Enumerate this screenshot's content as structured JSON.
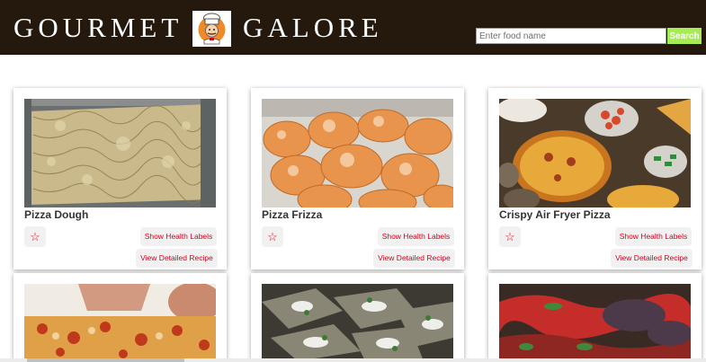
{
  "header": {
    "brand_left": "GOURMET",
    "brand_right": "GALORE",
    "logo_icon": "chef-logo-icon",
    "search_placeholder": "Enter food name",
    "search_button": "Search",
    "colors": {
      "background": "#25190e",
      "search_button": "#a8ec55",
      "accent": "#d9001b"
    }
  },
  "recipes": [
    {
      "title": "Pizza Dough",
      "image": "pizza-dough-photo",
      "health_label": "Show Health Labels",
      "recipe_label": "View Detailed Recipe",
      "star_icon": "star-outline-icon"
    },
    {
      "title": "Pizza Frizza",
      "image": "fried-dough-balls-photo",
      "health_label": "Show Health Labels",
      "recipe_label": "View Detailed Recipe",
      "star_icon": "star-outline-icon"
    },
    {
      "title": "Crispy Air Fryer Pizza",
      "image": "pizza-toppings-spread-photo",
      "health_label": "Show Health Labels",
      "recipe_label": "View Detailed Recipe",
      "star_icon": "star-outline-icon"
    },
    {
      "image": "pizza-with-hands-photo"
    },
    {
      "image": "herb-flatbread-photo"
    },
    {
      "image": "grilled-vegetables-photo"
    }
  ]
}
